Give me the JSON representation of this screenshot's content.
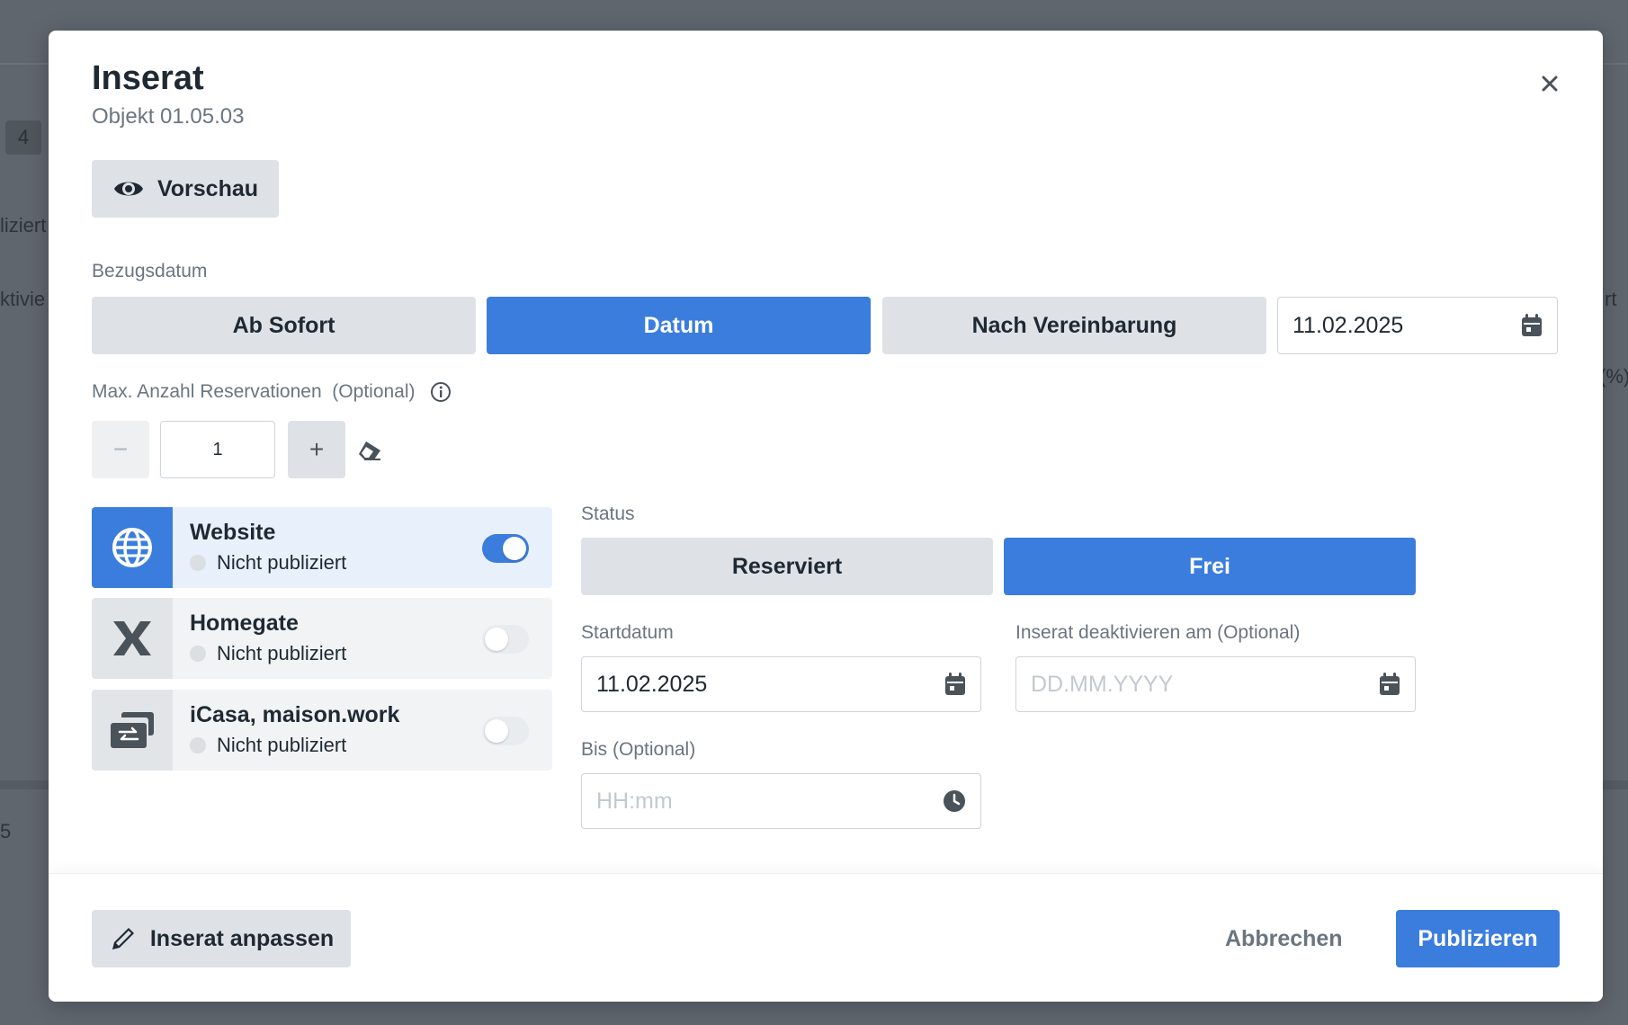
{
  "background": {
    "badge": "4",
    "frag_publiziert": "liziert",
    "frag_aktiviert": "ktivie",
    "frag_rt": "rt",
    "frag_percent": "(%)",
    "frag_five": "5"
  },
  "modal": {
    "title": "Inserat",
    "subtitle": "Objekt 01.05.03",
    "preview_label": "Vorschau",
    "move_in": {
      "label": "Bezugsdatum",
      "options": [
        "Ab Sofort",
        "Datum",
        "Nach Vereinbarung"
      ],
      "selected": "Datum",
      "date_value": "11.02.2025"
    },
    "reservations": {
      "label": "Max. Anzahl Reservationen  (Optional)",
      "value": "1",
      "minus": "−",
      "plus": "+"
    },
    "channels": [
      {
        "name": "Website",
        "status": "Nicht publiziert",
        "enabled": true,
        "icon": "globe-icon"
      },
      {
        "name": "Homegate",
        "status": "Nicht publiziert",
        "enabled": false,
        "icon": "homegate-logo-icon"
      },
      {
        "name": "iCasa, maison.work",
        "status": "Nicht publiziert",
        "enabled": false,
        "icon": "transfer-icon"
      }
    ],
    "status": {
      "label": "Status",
      "options": [
        "Reserviert",
        "Frei"
      ],
      "selected": "Frei"
    },
    "start_date": {
      "label": "Startdatum",
      "value": "11.02.2025"
    },
    "deactivate": {
      "label": "Inserat deaktivieren am (Optional)",
      "placeholder": "DD.MM.YYYY"
    },
    "until": {
      "label": "Bis (Optional)",
      "placeholder": "HH:mm"
    }
  },
  "footer": {
    "edit_label": "Inserat anpassen",
    "cancel_label": "Abbrechen",
    "publish_label": "Publizieren"
  },
  "colors": {
    "accent": "#3b7ddd",
    "button_gray": "#dee2e6",
    "overlay": "#5f666e"
  }
}
